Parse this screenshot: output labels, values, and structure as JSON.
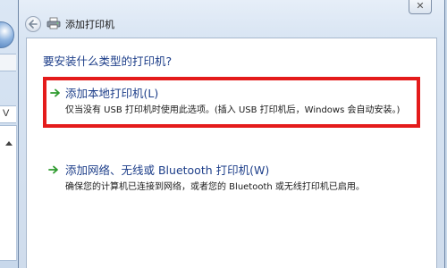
{
  "background_window": {
    "partial_text": "V"
  },
  "dialog": {
    "title": "添加打印机",
    "close_glyph": "✕",
    "question": "要安装什么类型的打印机?",
    "options": [
      {
        "title": "添加本地打印机(L)",
        "description": "仅当没有 USB 打印机时使用此选项。(插入 USB 打印机后，Windows 会自动安装。)",
        "icon": "green-arrow-icon",
        "highlighted": true
      },
      {
        "title": "添加网络、无线或 Bluetooth 打印机(W)",
        "description": "确保您的计算机已连接到网络，或者您的 Bluetooth 或无线打印机已启用。",
        "icon": "green-arrow-icon",
        "highlighted": false
      }
    ]
  },
  "colors": {
    "link_blue": "#1e3f8a",
    "highlight_red": "#e41b1b",
    "arrow_green": "#2e9b2e"
  }
}
